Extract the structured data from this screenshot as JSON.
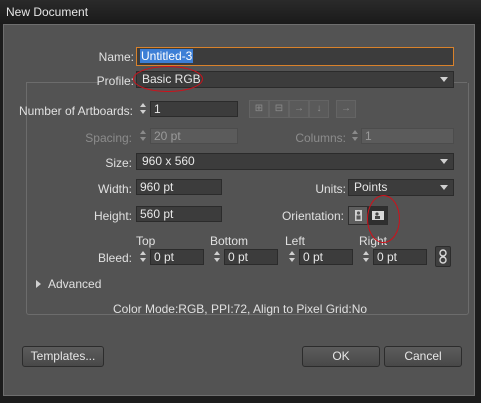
{
  "window": {
    "title": "New Document"
  },
  "name": {
    "label": "Name:",
    "value": "Untitled-3"
  },
  "profile": {
    "label": "Profile:",
    "value": "Basic RGB"
  },
  "artboards": {
    "label": "Number of Artboards:",
    "value": "1"
  },
  "spacing": {
    "label": "Spacing:",
    "value": "20 pt"
  },
  "columns": {
    "label": "Columns:",
    "value": "1"
  },
  "size": {
    "label": "Size:",
    "value": "960 x 560"
  },
  "width": {
    "label": "Width:",
    "value": "960 pt"
  },
  "units": {
    "label": "Units:",
    "value": "Points"
  },
  "height": {
    "label": "Height:",
    "value": "560 pt"
  },
  "orientation": {
    "label": "Orientation:"
  },
  "bleed": {
    "label": "Bleed:",
    "top_label": "Top",
    "top": "0 pt",
    "bottom_label": "Bottom",
    "bottom": "0 pt",
    "left_label": "Left",
    "left": "0 pt",
    "right_label": "Right",
    "right": "0 pt"
  },
  "advanced": {
    "label": "Advanced"
  },
  "summary": "Color Mode:RGB, PPI:72, Align to Pixel Grid:No",
  "buttons": {
    "templates": "Templates...",
    "ok": "OK",
    "cancel": "Cancel"
  },
  "colors": {
    "annotation": "#d0101a",
    "selection": "#3d7fd6"
  }
}
